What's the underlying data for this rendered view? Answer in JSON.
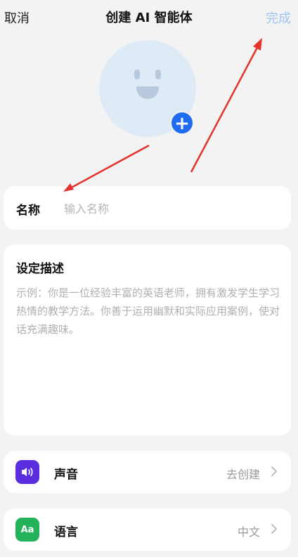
{
  "header": {
    "cancel_label": "取消",
    "title": "创建 AI 智能体",
    "done_label": "完成"
  },
  "avatar": {
    "add_icon": "plus-icon"
  },
  "name_field": {
    "label": "名称",
    "placeholder": "输入名称",
    "value": ""
  },
  "description": {
    "label": "设定描述",
    "placeholder": "示例：你是一位经验丰富的英语老师，拥有激发学生学习热情的教学方法。你善于运用幽默和实际应用案例，使对话充满趣味。"
  },
  "settings": {
    "voice": {
      "label": "声音",
      "value": "去创建",
      "icon": "speaker-icon"
    },
    "language": {
      "label": "语言",
      "value": "中文",
      "icon": "Aa"
    }
  },
  "colors": {
    "accent": "#1f6bf2",
    "done_disabled": "#9cc3f0",
    "voice_icon_bg": "#5b2fe0",
    "language_icon_bg": "#22b35a",
    "annotation_arrow": "#e5322d"
  }
}
